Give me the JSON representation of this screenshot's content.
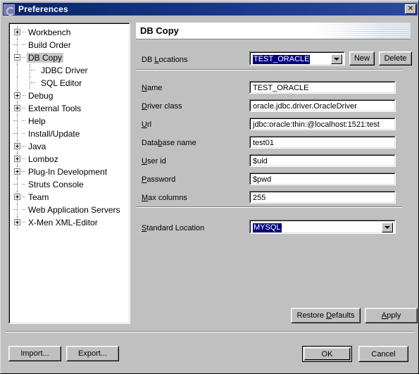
{
  "window": {
    "title": "Preferences",
    "icon": "eclipse-icon",
    "close_label": "✕"
  },
  "tree": {
    "items": [
      {
        "label": "Workbench",
        "twisty": "plus",
        "level": 0,
        "selected": false
      },
      {
        "label": "Build Order",
        "twisty": "none",
        "level": 0,
        "selected": false
      },
      {
        "label": "DB Copy",
        "twisty": "minus",
        "level": 0,
        "selected": true
      },
      {
        "label": "JDBC Driver",
        "twisty": "none",
        "level": 1,
        "selected": false
      },
      {
        "label": "SQL Editor",
        "twisty": "none",
        "level": 1,
        "selected": false
      },
      {
        "label": "Debug",
        "twisty": "plus",
        "level": 0,
        "selected": false
      },
      {
        "label": "External Tools",
        "twisty": "plus",
        "level": 0,
        "selected": false
      },
      {
        "label": "Help",
        "twisty": "none",
        "level": 0,
        "selected": false
      },
      {
        "label": "Install/Update",
        "twisty": "none",
        "level": 0,
        "selected": false
      },
      {
        "label": "Java",
        "twisty": "plus",
        "level": 0,
        "selected": false
      },
      {
        "label": "Lomboz",
        "twisty": "plus",
        "level": 0,
        "selected": false
      },
      {
        "label": "Plug-In Development",
        "twisty": "plus",
        "level": 0,
        "selected": false
      },
      {
        "label": "Struts Console",
        "twisty": "none",
        "level": 0,
        "selected": false
      },
      {
        "label": "Team",
        "twisty": "plus",
        "level": 0,
        "selected": false
      },
      {
        "label": "Web Application Servers",
        "twisty": "none",
        "level": 0,
        "selected": false
      },
      {
        "label": "X-Men XML-Editor",
        "twisty": "plus",
        "level": 0,
        "selected": false
      }
    ]
  },
  "page": {
    "title": "DB Copy",
    "db_locations": {
      "label_pre": "DB ",
      "label_mnemonic": "L",
      "label_post": "ocations",
      "value": "TEST_ORACLE",
      "new_label": "New",
      "delete_label": "Delete"
    },
    "fields": [
      {
        "label_pre": "",
        "mnemonic": "N",
        "label_post": "ame",
        "value": "TEST_ORACLE"
      },
      {
        "label_pre": "",
        "mnemonic": "D",
        "label_post": "river class",
        "value": "oracle.jdbc.driver.OracleDriver"
      },
      {
        "label_pre": "",
        "mnemonic": "U",
        "label_post": "rl",
        "value": "jdbc:oracle:thin:@localhost:1521:test"
      },
      {
        "label_pre": "Data",
        "mnemonic": "b",
        "label_post": "ase name",
        "value": "test01"
      },
      {
        "label_pre": "",
        "mnemonic": "U",
        "label_post": "ser id",
        "value": "$uid"
      },
      {
        "label_pre": "",
        "mnemonic": "P",
        "label_post": "assword",
        "value": "$pwd"
      },
      {
        "label_pre": "",
        "mnemonic": "M",
        "label_post": "ax columns",
        "value": "255"
      }
    ],
    "standard_location": {
      "label_pre": "",
      "mnemonic": "S",
      "label_post": "tandard Location",
      "value": "MYSQL"
    },
    "restore_defaults": {
      "pre": "Restore ",
      "mnemonic": "D",
      "post": "efaults"
    },
    "apply": {
      "pre": "",
      "mnemonic": "A",
      "post": "pply"
    }
  },
  "footer": {
    "import_label": "Import...",
    "export_label": "Export...",
    "ok_label": "OK",
    "cancel_label": "Cancel"
  },
  "colors": {
    "titlebar": "#0a246a",
    "face": "#c0c0c0",
    "selection": "#000080",
    "tree_selection": "#c8c8c8"
  }
}
